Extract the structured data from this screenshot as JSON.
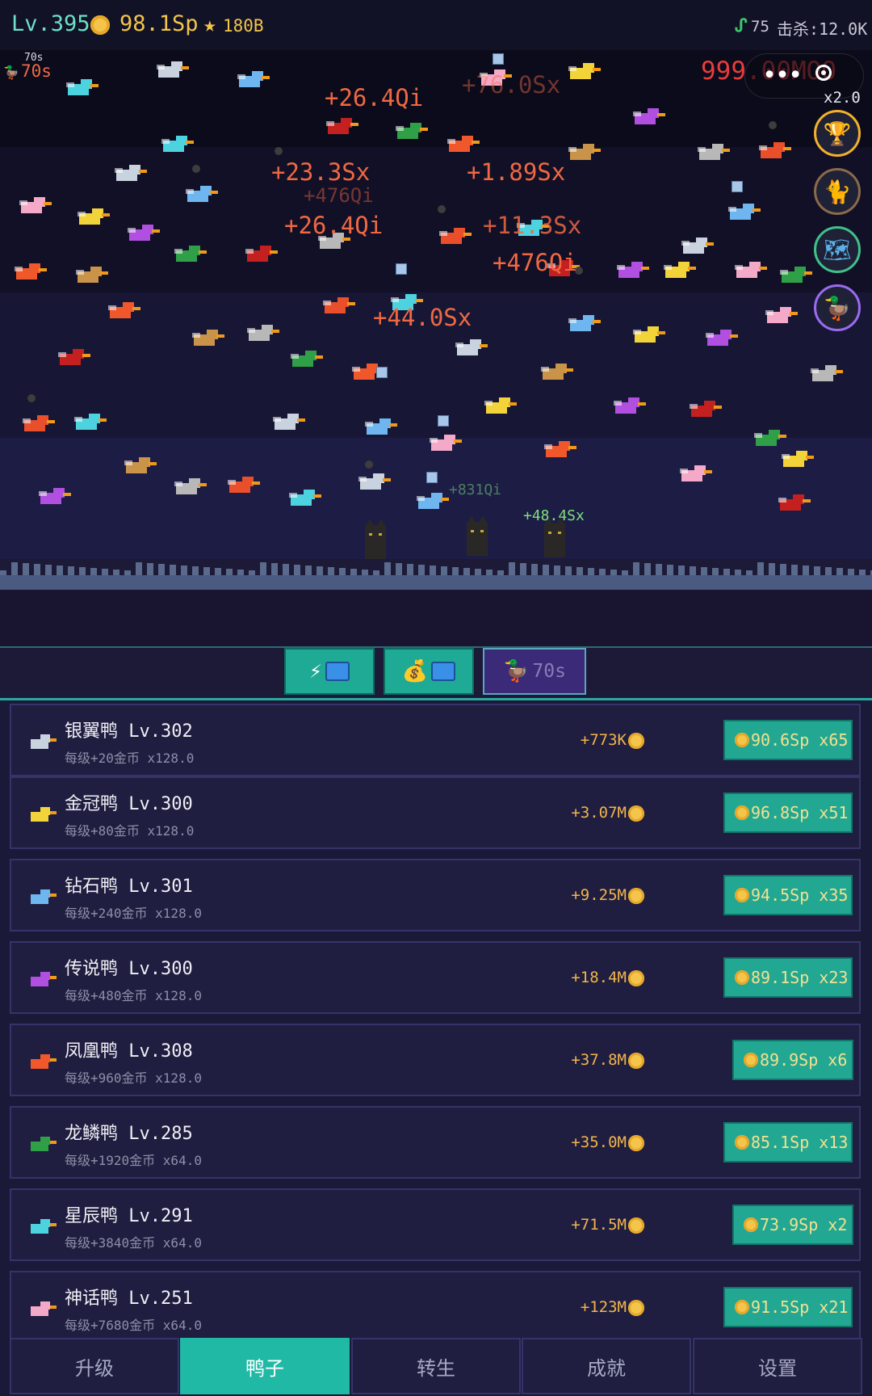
{
  "status": {
    "level": "Lv.395",
    "gold": "98.1Sp",
    "stars": "180B",
    "kills_prefix": "75",
    "kills": "击杀:12.0K",
    "icons": [
      "coin-icon",
      "star-icon",
      "snake-icon"
    ]
  },
  "field": {
    "timer_small": "70s",
    "timer_big": "70s",
    "banner": "999.00MOO",
    "speed": "x2.0",
    "floats": [
      "+26.4Qi",
      "+76.0Sx",
      "+23.3Sx",
      "+1.89Sx",
      "+476Qi",
      "+26.4Qi",
      "+11.3Sx",
      "+476Qi",
      "+44.0Sx"
    ],
    "green_floats": [
      "+831Qi",
      "+48.4Sx"
    ],
    "side_buttons": [
      "trophy-icon",
      "cat-icon",
      "map-icon",
      "duck-icon"
    ]
  },
  "boosts": {
    "speed_icon": "⚡",
    "money_icon": "💰",
    "duck_timer": "70s"
  },
  "ducks": [
    {
      "name": "银翼鸭 Lv.302",
      "desc": "每级+20金币 x128.0",
      "income": "+773K",
      "price": "90.6Sp x65",
      "color": "#c9d3e0"
    },
    {
      "name": "金冠鸭 Lv.300",
      "desc": "每级+80金币 x128.0",
      "income": "+3.07M",
      "price": "96.8Sp x51",
      "color": "#f2d33a"
    },
    {
      "name": "钻石鸭 Lv.301",
      "desc": "每级+240金币 x128.0",
      "income": "+9.25M",
      "price": "94.5Sp x35",
      "color": "#6fb6f0"
    },
    {
      "name": "传说鸭 Lv.300",
      "desc": "每级+480金币 x128.0",
      "income": "+18.4M",
      "price": "89.1Sp x23",
      "color": "#b04fe0"
    },
    {
      "name": "凤凰鸭 Lv.308",
      "desc": "每级+960金币 x128.0",
      "income": "+37.8M",
      "price": "89.9Sp x6",
      "color": "#f0582c"
    },
    {
      "name": "龙鳞鸭 Lv.285",
      "desc": "每级+1920金币 x64.0",
      "income": "+35.0M",
      "price": "85.1Sp x13",
      "color": "#2fa048"
    },
    {
      "name": "星辰鸭 Lv.291",
      "desc": "每级+3840金币 x64.0",
      "income": "+71.5M",
      "price": "73.9Sp x2",
      "color": "#4dd3e0"
    },
    {
      "name": "神话鸭 Lv.251",
      "desc": "每级+7680金币 x64.0",
      "income": "+123M",
      "price": "91.5Sp x21",
      "color": "#f5a9c8"
    }
  ],
  "tabs": [
    "升级",
    "鸭子",
    "转生",
    "成就",
    "设置"
  ],
  "active_tab": "鸭子",
  "colors": {
    "accent": "#20b9a6",
    "gold": "#f3c54a",
    "damage": "#f06842"
  }
}
